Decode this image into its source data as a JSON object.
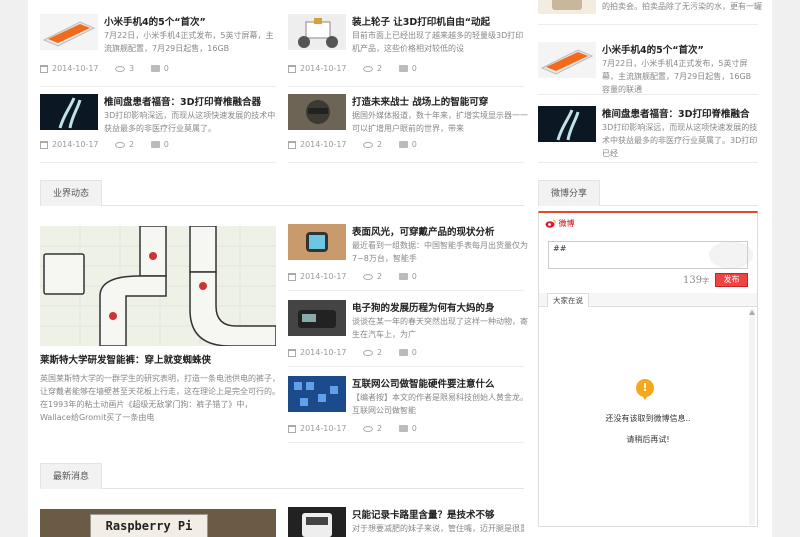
{
  "top_articles": [
    {
      "title": "小米手机4的5个“首次”",
      "desc": "7月22日，小米手机4正式发布，5英寸屏幕，主流旗舰配置，7月29日起售，16GB",
      "date": "2014-10-17",
      "views": "3",
      "comments": "0"
    },
    {
      "title": "装上轮子 让3D打印机自由“动起",
      "desc": "目前市面上已经出现了越来越多的轻量级3D打印机产品，这些价格相对较低的设",
      "date": "2014-10-17",
      "views": "2",
      "comments": "0"
    },
    {
      "title": "椎间盘患者福音：3D打印脊椎融合器",
      "desc": "3D打印影响深远，而现从这项快速发展的技术中获益最多的非医疗行业莫属了。",
      "date": "2014-10-17",
      "views": "2",
      "comments": "0"
    },
    {
      "title": "打造未来战士 战场上的智能可穿",
      "desc": "据国外媒体报道，数十年来，扩增实境显示器一一可以扩增用户眼前的世界，带来",
      "date": "2014-10-17",
      "views": "2",
      "comments": "0"
    }
  ],
  "sidebar_articles": [
    {
      "desc": "的拍卖会。拍卖品除了无污染的水，更有一罐"
    },
    {
      "title": "小米手机4的5个“首次”",
      "desc": "7月22日，小米手机4正式发布，5英寸屏幕，主流旗舰配置，7月29日起售，16GB容量的联通"
    },
    {
      "title": "椎间盘患者福音：3D打印脊椎融合",
      "desc": "3D打印影响深远，而现从这项快速发展的技术中获益最多的非医疗行业莫属了。3D打印已经"
    }
  ],
  "industry": {
    "tab_label": "业界动态",
    "feature": {
      "title": "莱斯特大学研发智能裤：穿上就变蜘蛛侠",
      "desc": "英国莱斯特大学的一群学生的研究表明，打造一条电池供电的裤子，让穿戴者能够在墙壁甚至天花板上行走，这在理论上是完全可行的。在1993年的粘土动画片《超级无敌掌门狗：裤子错了》中，Wallace给Gromit买了一条由电"
    },
    "articles": [
      {
        "title": "表面风光，可穿戴产品的现状分析",
        "desc": "最近看到一组数据：中国智能手表每月出货量仅为7~8万台，智能手",
        "date": "2014-10-17",
        "views": "2",
        "comments": "0"
      },
      {
        "title": "电子狗的发展历程为何有大妈的身",
        "desc": "谈谈在某一年的春天突然出现了这样一种动物，寄生在汽车上，为广",
        "date": "2014-10-17",
        "views": "2",
        "comments": "0"
      },
      {
        "title": "互联网公司做智能硬件要注意什么",
        "desc": "【编者按】本文的作者是限易科技创始人黄金龙。互联网公司做智能",
        "date": "2014-10-17",
        "views": "2",
        "comments": "0"
      }
    ]
  },
  "latest": {
    "tab_label": "最新消息",
    "feature_img_text": "Raspberry Pi",
    "articles": [
      {
        "title": "只能记录卡路里含量？是技术不够",
        "desc": "对于想要减肥的妹子来说，管住嘴，迈开腿是很重"
      }
    ]
  },
  "weibo": {
    "tab_label": "微博分享",
    "logo_label": "微博",
    "input_value": "##",
    "char_count": "139",
    "char_unit": "字",
    "send_label": "发布",
    "feed_tab": "大家在说",
    "empty_line1": "还没有该取到微博信息..",
    "empty_line2": "请稍后再试!"
  },
  "colors": {
    "accent": "#e14b2c",
    "send": "#e44444",
    "pin": "#f5a81c"
  }
}
